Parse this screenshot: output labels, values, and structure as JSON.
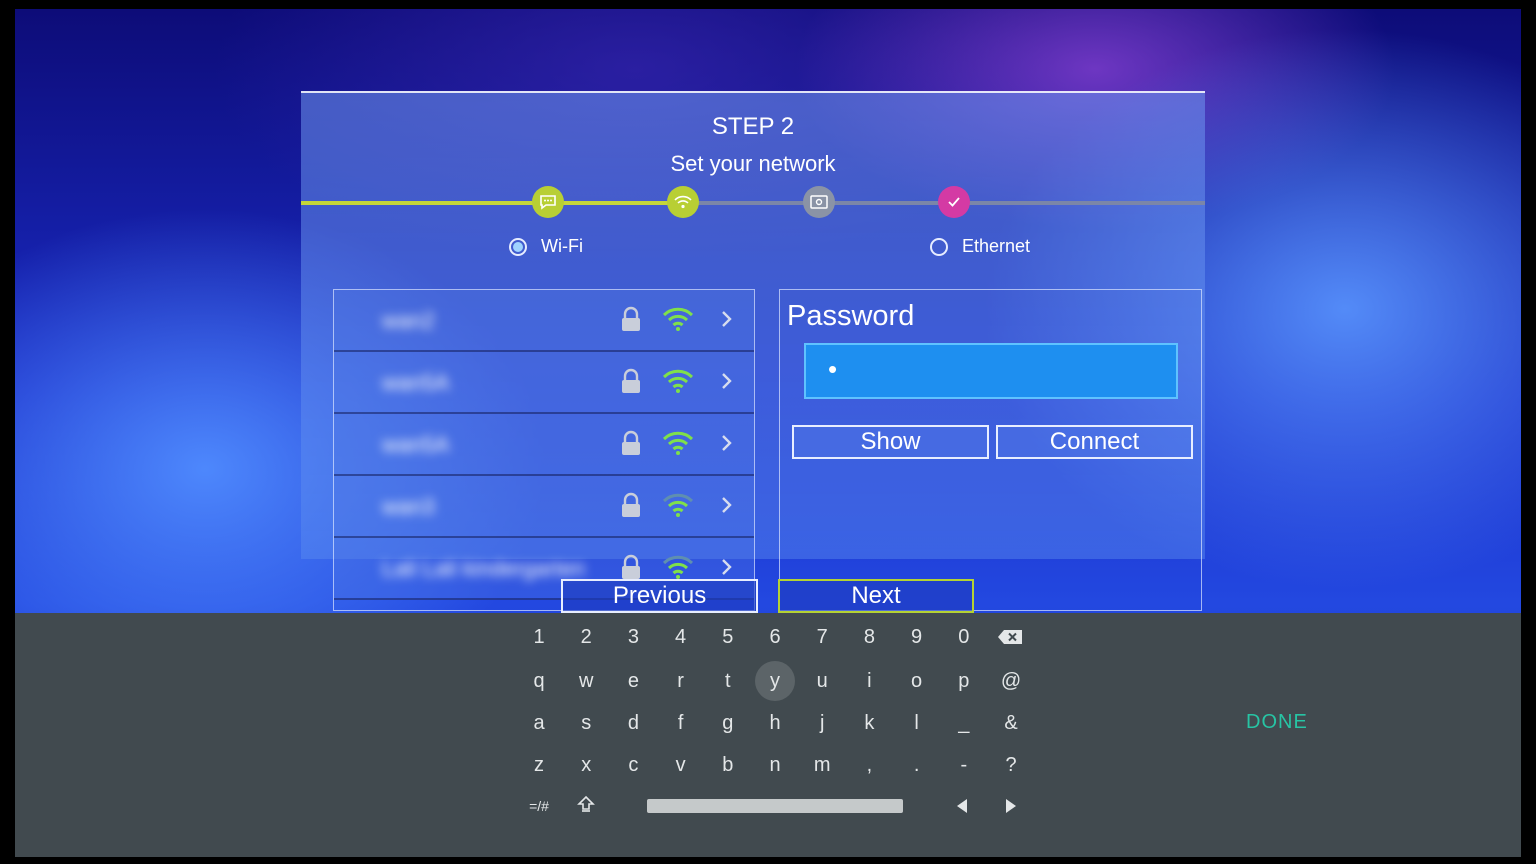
{
  "wizard": {
    "step_title": "STEP 2",
    "step_subtitle": "Set your network",
    "progress_fraction": 0.42,
    "steps": [
      {
        "icon": "chat-bubble-icon",
        "state": "done"
      },
      {
        "icon": "wifi-icon",
        "state": "current"
      },
      {
        "icon": "display-settings-icon",
        "state": "pending"
      },
      {
        "icon": "checkmark-icon",
        "state": "final"
      }
    ],
    "colors": {
      "active": "#b8cf34",
      "pending": "#8a93a6",
      "final": "#d43aa4"
    }
  },
  "connection_type": {
    "wifi_label": "Wi-Fi",
    "ethernet_label": "Ethernet",
    "selected": "wifi"
  },
  "networks": [
    {
      "name": "wan2",
      "locked": true,
      "signal": "strong"
    },
    {
      "name": "wan5A",
      "locked": true,
      "signal": "strong"
    },
    {
      "name": "wan5A",
      "locked": true,
      "signal": "strong"
    },
    {
      "name": "wan3",
      "locked": true,
      "signal": "medium"
    },
    {
      "name": "Lali Lali kindergarten",
      "locked": true,
      "signal": "medium"
    }
  ],
  "password": {
    "label": "Password",
    "value": "•",
    "show_label": "Show",
    "connect_label": "Connect"
  },
  "navigation": {
    "previous_label": "Previous",
    "next_label": "Next"
  },
  "keyboard": {
    "rows": [
      [
        "1",
        "2",
        "3",
        "4",
        "5",
        "6",
        "7",
        "8",
        "9",
        "0"
      ],
      [
        "q",
        "w",
        "e",
        "r",
        "t",
        "y",
        "u",
        "i",
        "o",
        "p",
        "@"
      ],
      [
        "a",
        "s",
        "d",
        "f",
        "g",
        "h",
        "j",
        "k",
        "l",
        "_",
        "&"
      ],
      [
        "z",
        "x",
        "c",
        "v",
        "b",
        "n",
        "m",
        ",",
        ".",
        "-",
        "?"
      ]
    ],
    "symbols_label": "=/#",
    "focused_key": "y",
    "done_label": "DONE",
    "icons": [
      "backspace-icon",
      "shift-icon",
      "cursor-left-icon",
      "cursor-right-icon"
    ],
    "accent": "#27c4a4"
  }
}
